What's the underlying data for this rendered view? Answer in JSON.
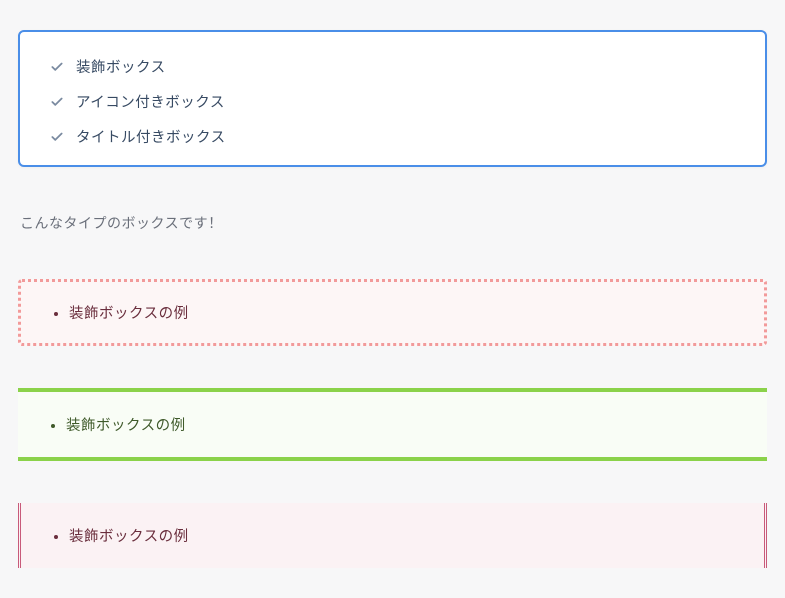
{
  "box_blue": {
    "items": [
      "装飾ボックス",
      "アイコン付きボックス",
      "タイトル付きボックス"
    ]
  },
  "caption": "こんなタイプのボックスです！",
  "box_dotted": {
    "items": [
      "装飾ボックスの例"
    ]
  },
  "box_green": {
    "items": [
      "装飾ボックスの例"
    ]
  },
  "box_redline": {
    "items": [
      "装飾ボックスの例"
    ]
  }
}
